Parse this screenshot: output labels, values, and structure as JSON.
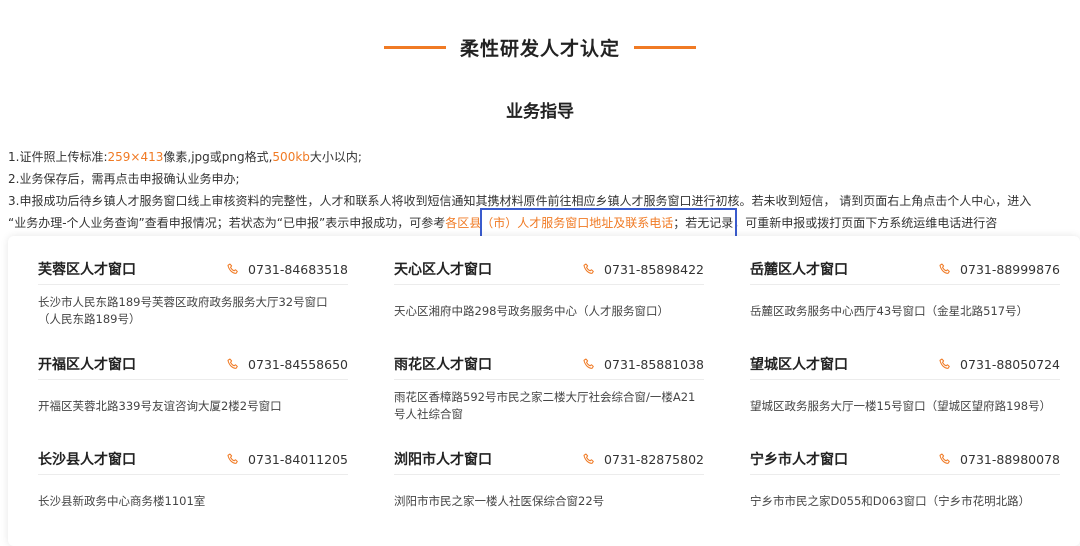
{
  "page": {
    "title": "柔性研发人才认定",
    "subtitle": "业务指导"
  },
  "guide": {
    "line1_a": "1.证件照上传标准:",
    "line1_size": "259×413",
    "line1_b": "像素,jpg或png格式,",
    "line1_kb": "500kb",
    "line1_c": "大小以内;",
    "line2": "2.业务保存后，需再点击申报确认业务申办;",
    "line3": "3.申报成功后待乡镇人才服务窗口线上审核资料的完整性，人才和联系人将收到短信通知其携材料原件前往相应乡镇人才服务窗口进行初核。若未收到短信， 请到页面右上角点击个人中心，进入",
    "line4_a": "“业务办理-个人业务查询”查看申报情况；若状态为“已申报”表示申报成功，可参考",
    "line4_link": "各区县（市）人才服务窗口地址及联系电话",
    "line4_b": "；若无记录，可重新申报或拨打页面下方系统运维电话进行咨"
  },
  "colors": {
    "accent": "#f07a24",
    "highlight": "#3a5bcd"
  },
  "windows": [
    {
      "name": "芙蓉区人才窗口",
      "phone": "0731-84683518",
      "address": "长沙市人民东路189号芙蓉区政府政务服务大厅32号窗口（人民东路189号）"
    },
    {
      "name": "天心区人才窗口",
      "phone": "0731-85898422",
      "address": "天心区湘府中路298号政务服务中心（人才服务窗口）"
    },
    {
      "name": "岳麓区人才窗口",
      "phone": "0731-88999876",
      "address": "岳麓区政务服务中心西厅43号窗口（金星北路517号）"
    },
    {
      "name": "开福区人才窗口",
      "phone": "0731-84558650",
      "address": "开福区芙蓉北路339号友谊咨询大厦2楼2号窗口"
    },
    {
      "name": "雨花区人才窗口",
      "phone": "0731-85881038",
      "address": "雨花区香樟路592号市民之家二楼大厅社会综合窗/一楼A21号人社综合窗"
    },
    {
      "name": "望城区人才窗口",
      "phone": "0731-88050724",
      "address": "望城区政务服务大厅一楼15号窗口（望城区望府路198号）"
    },
    {
      "name": "长沙县人才窗口",
      "phone": "0731-84011205",
      "address": "长沙县新政务中心商务楼1101室"
    },
    {
      "name": "浏阳市人才窗口",
      "phone": "0731-82875802",
      "address": "浏阳市市民之家一楼人社医保综合窗22号"
    },
    {
      "name": "宁乡市人才窗口",
      "phone": "0731-88980078",
      "address": "宁乡市市民之家D055和D063窗口（宁乡市花明北路）"
    }
  ],
  "icons": {
    "phone": "phone-icon"
  }
}
